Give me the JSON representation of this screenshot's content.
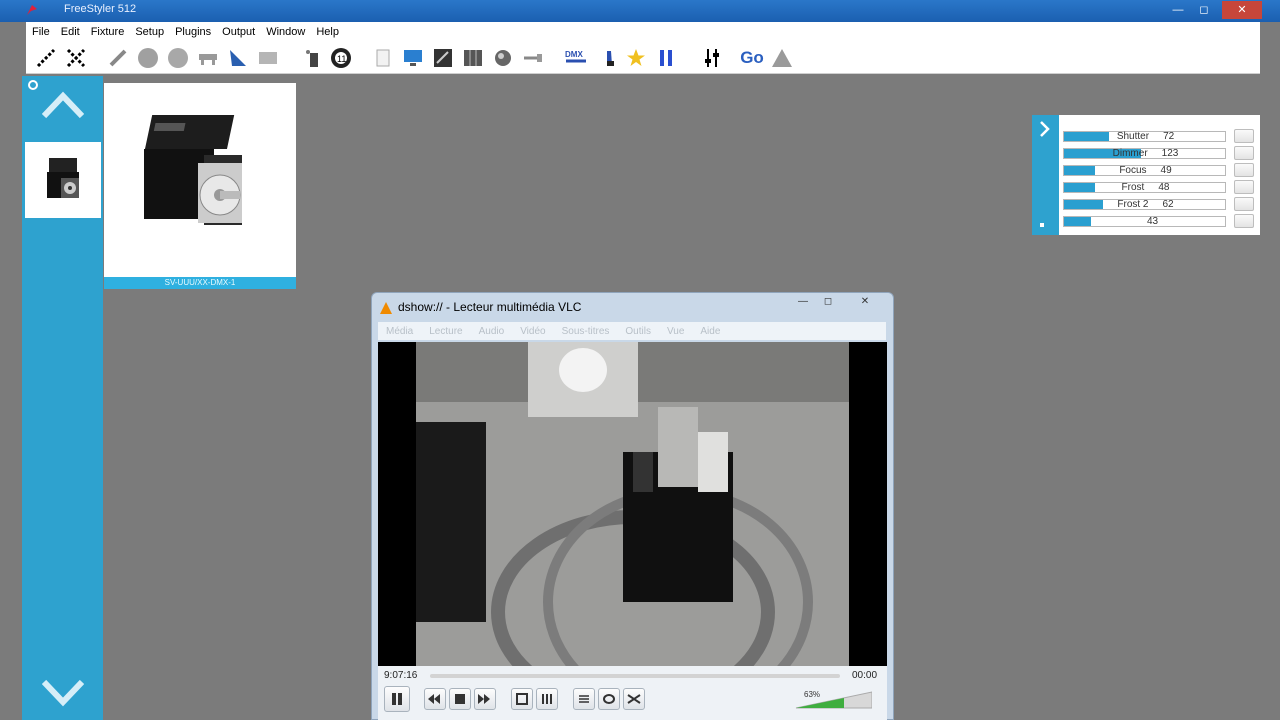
{
  "window": {
    "title": "FreeStyler 512"
  },
  "menu": [
    "File",
    "Edit",
    "Fixture",
    "Setup",
    "Plugins",
    "Output",
    "Window",
    "Help"
  ],
  "toolbar": {
    "go_label": "Go"
  },
  "fixture": {
    "label": "SV-UUU/XX-DMX-1"
  },
  "channels": [
    {
      "label": "Shutter",
      "value": "72",
      "level": 0.28
    },
    {
      "label": "Dimmer",
      "value": "123",
      "level": 0.48
    },
    {
      "label": "Focus",
      "value": "49",
      "level": 0.19
    },
    {
      "label": "Frost",
      "value": "48",
      "level": 0.19
    },
    {
      "label": "Frost 2",
      "value": "62",
      "level": 0.24
    },
    {
      "label": "",
      "value": "43",
      "level": 0.17
    }
  ],
  "vlc": {
    "title": "dshow:// - Lecteur multimédia VLC",
    "menu": [
      "Média",
      "Lecture",
      "Audio",
      "Vidéo",
      "Sous-titres",
      "Outils",
      "Vue",
      "Aide"
    ],
    "elapsed": "9:07:16",
    "remaining": "00:00",
    "volume": "63%"
  },
  "colors": {
    "accent": "#2ea2cf",
    "background": "#7b7b7b"
  }
}
